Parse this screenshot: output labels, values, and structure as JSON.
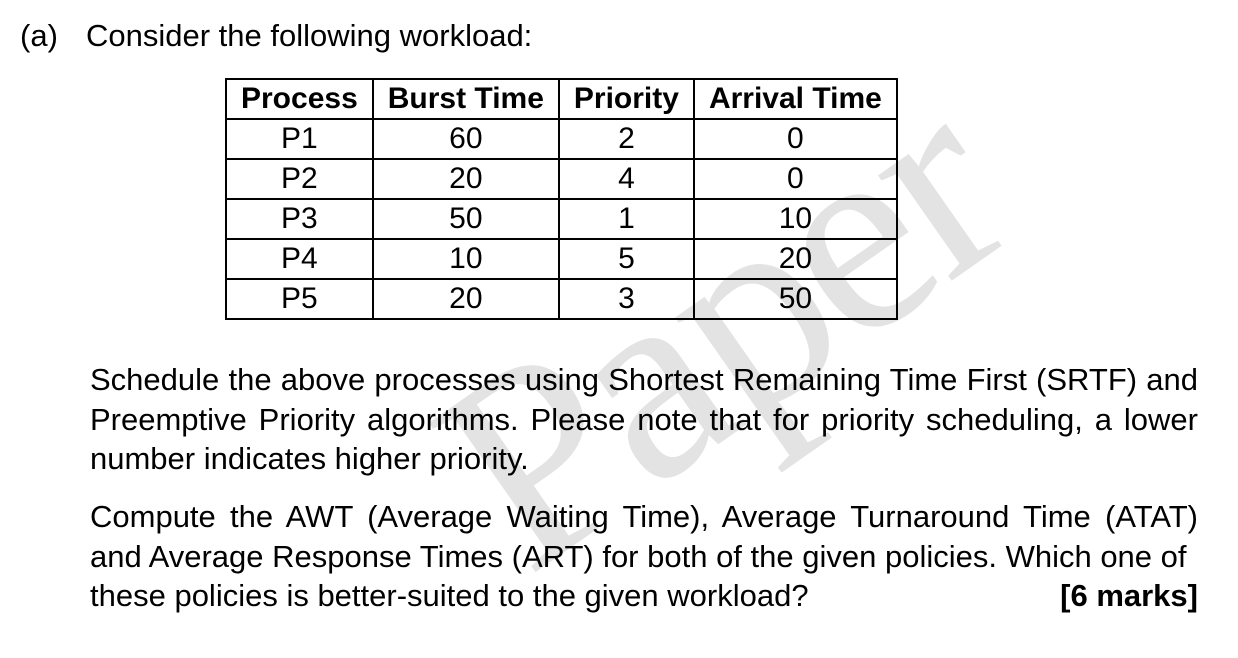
{
  "watermark": "Paper",
  "question": {
    "label": "(a)",
    "intro": "Consider the following workload:"
  },
  "table": {
    "headers": [
      "Process",
      "Burst Time",
      "Priority",
      "Arrival Time"
    ],
    "rows": [
      {
        "process": "P1",
        "burst": "60",
        "priority": "2",
        "arrival": "0"
      },
      {
        "process": "P2",
        "burst": "20",
        "priority": "4",
        "arrival": "0"
      },
      {
        "process": "P3",
        "burst": "50",
        "priority": "1",
        "arrival": "10"
      },
      {
        "process": "P4",
        "burst": "10",
        "priority": "5",
        "arrival": "20"
      },
      {
        "process": "P5",
        "burst": "20",
        "priority": "3",
        "arrival": "50"
      }
    ]
  },
  "paragraphs": {
    "p1": "Schedule the above processes using Shortest Remaining Time First (SRTF) and Preemptive Priority algorithms. Please note that for priority scheduling, a lower number indicates higher priority.",
    "p2_part1": "Compute the AWT (Average Waiting Time), Average Turnaround Time (ATAT) and Average Response Times (ART) for both of the given policies. Which one of ",
    "p2_lastline": "these policies is better-suited to the given workload?",
    "marks": "[6 marks]"
  }
}
